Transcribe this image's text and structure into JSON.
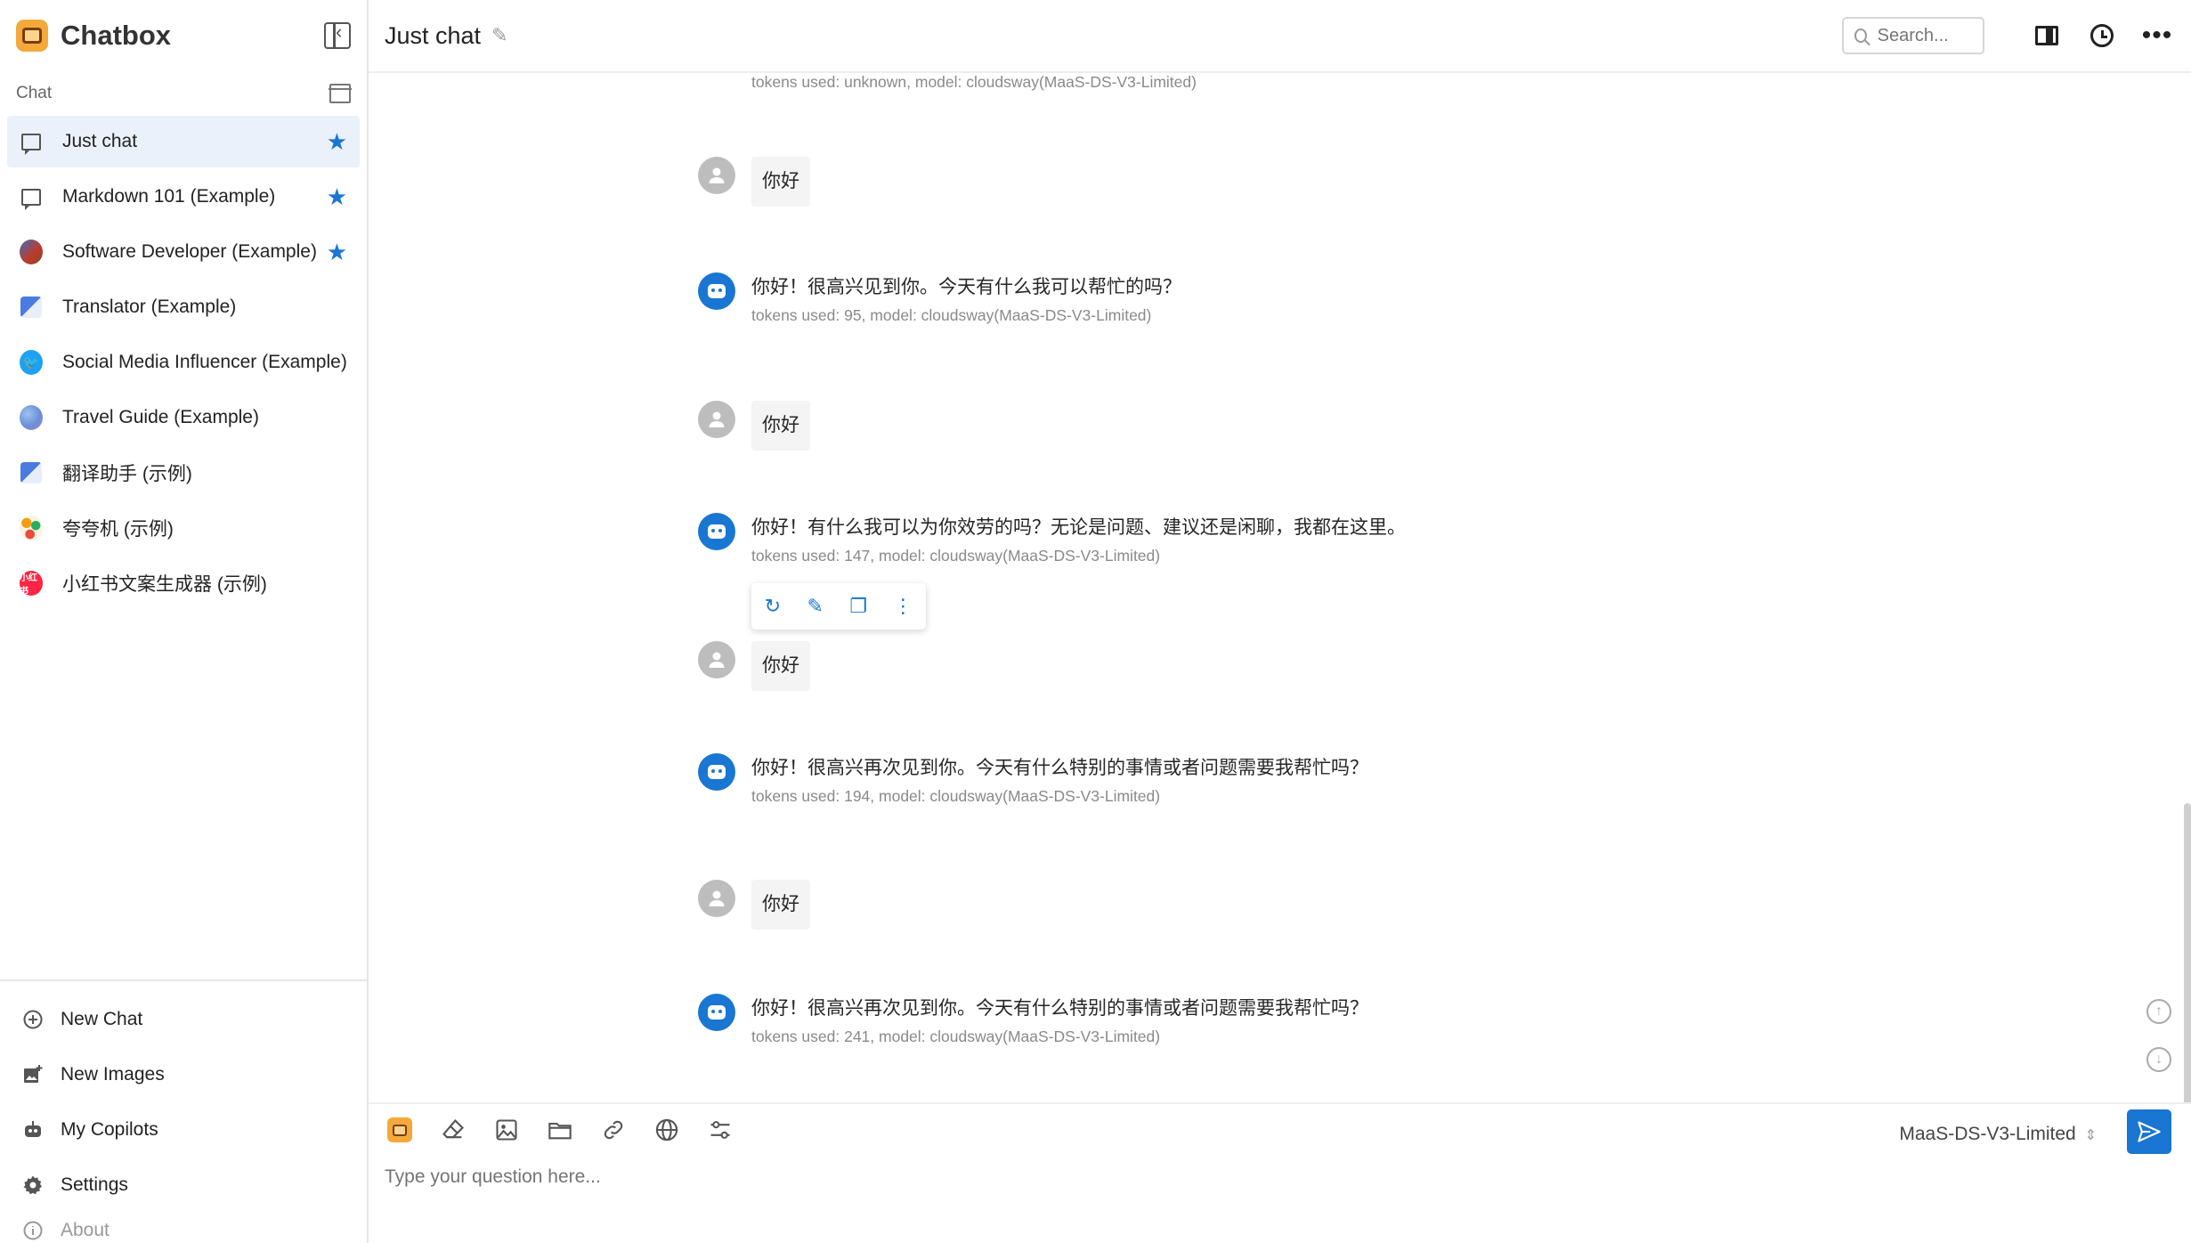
{
  "app": {
    "title": "Chatbox",
    "accent_color": "#1976d2"
  },
  "sidebar": {
    "section_label": "Chat",
    "items": [
      {
        "label": "Just chat",
        "icon": "chat-bubble-icon",
        "starred": true,
        "selected": true
      },
      {
        "label": "Markdown 101 (Example)",
        "icon": "chat-bubble-icon",
        "starred": true
      },
      {
        "label": "Software Developer (Example)",
        "icon": "developer-avatar-icon",
        "starred": true
      },
      {
        "label": "Translator (Example)",
        "icon": "translator-avatar-icon",
        "starred": false
      },
      {
        "label": "Social Media Influencer (Example)",
        "icon": "twitter-avatar-icon",
        "starred": false
      },
      {
        "label": "Travel Guide (Example)",
        "icon": "globe-avatar-icon",
        "starred": false
      },
      {
        "label": "翻译助手 (示例)",
        "icon": "translator-avatar-icon",
        "starred": false
      },
      {
        "label": "夸夸机 (示例)",
        "icon": "flower-avatar-icon",
        "starred": false
      },
      {
        "label": "小红书文案生成器 (示例)",
        "icon": "xiaohongshu-avatar-icon",
        "starred": false
      }
    ],
    "bottom": {
      "new_chat": "New Chat",
      "new_images": "New Images",
      "my_copilots": "My Copilots",
      "settings": "Settings",
      "about": "About"
    }
  },
  "header": {
    "chat_title": "Just chat",
    "search_placeholder": "Search..."
  },
  "messages": [
    {
      "role": "assistant",
      "meta": "tokens used: unknown, model: cloudsway(MaaS-DS-V3-Limited)"
    },
    {
      "role": "user",
      "text": "你好"
    },
    {
      "role": "assistant",
      "text": "你好！很高兴见到你。今天有什么我可以帮忙的吗？",
      "meta": "tokens used: 95, model: cloudsway(MaaS-DS-V3-Limited)"
    },
    {
      "role": "user",
      "text": "你好"
    },
    {
      "role": "assistant",
      "text": "你好！有什么我可以为你效劳的吗？无论是问题、建议还是闲聊，我都在这里。",
      "meta": "tokens used: 147, model: cloudsway(MaaS-DS-V3-Limited)"
    },
    {
      "role": "user",
      "text": "你好"
    },
    {
      "role": "assistant",
      "text": "你好！很高兴再次见到你。今天有什么特别的事情或者问题需要我帮忙吗？",
      "meta": "tokens used: 194, model: cloudsway(MaaS-DS-V3-Limited)"
    },
    {
      "role": "user",
      "text": "你好"
    },
    {
      "role": "assistant",
      "text": "你好！很高兴再次见到你。今天有什么特别的事情或者问题需要我帮忙吗？",
      "meta": "tokens used: 241, model: cloudsway(MaaS-DS-V3-Limited)"
    }
  ],
  "composer": {
    "placeholder": "Type your question here...",
    "model": "MaaS-DS-V3-Limited"
  }
}
